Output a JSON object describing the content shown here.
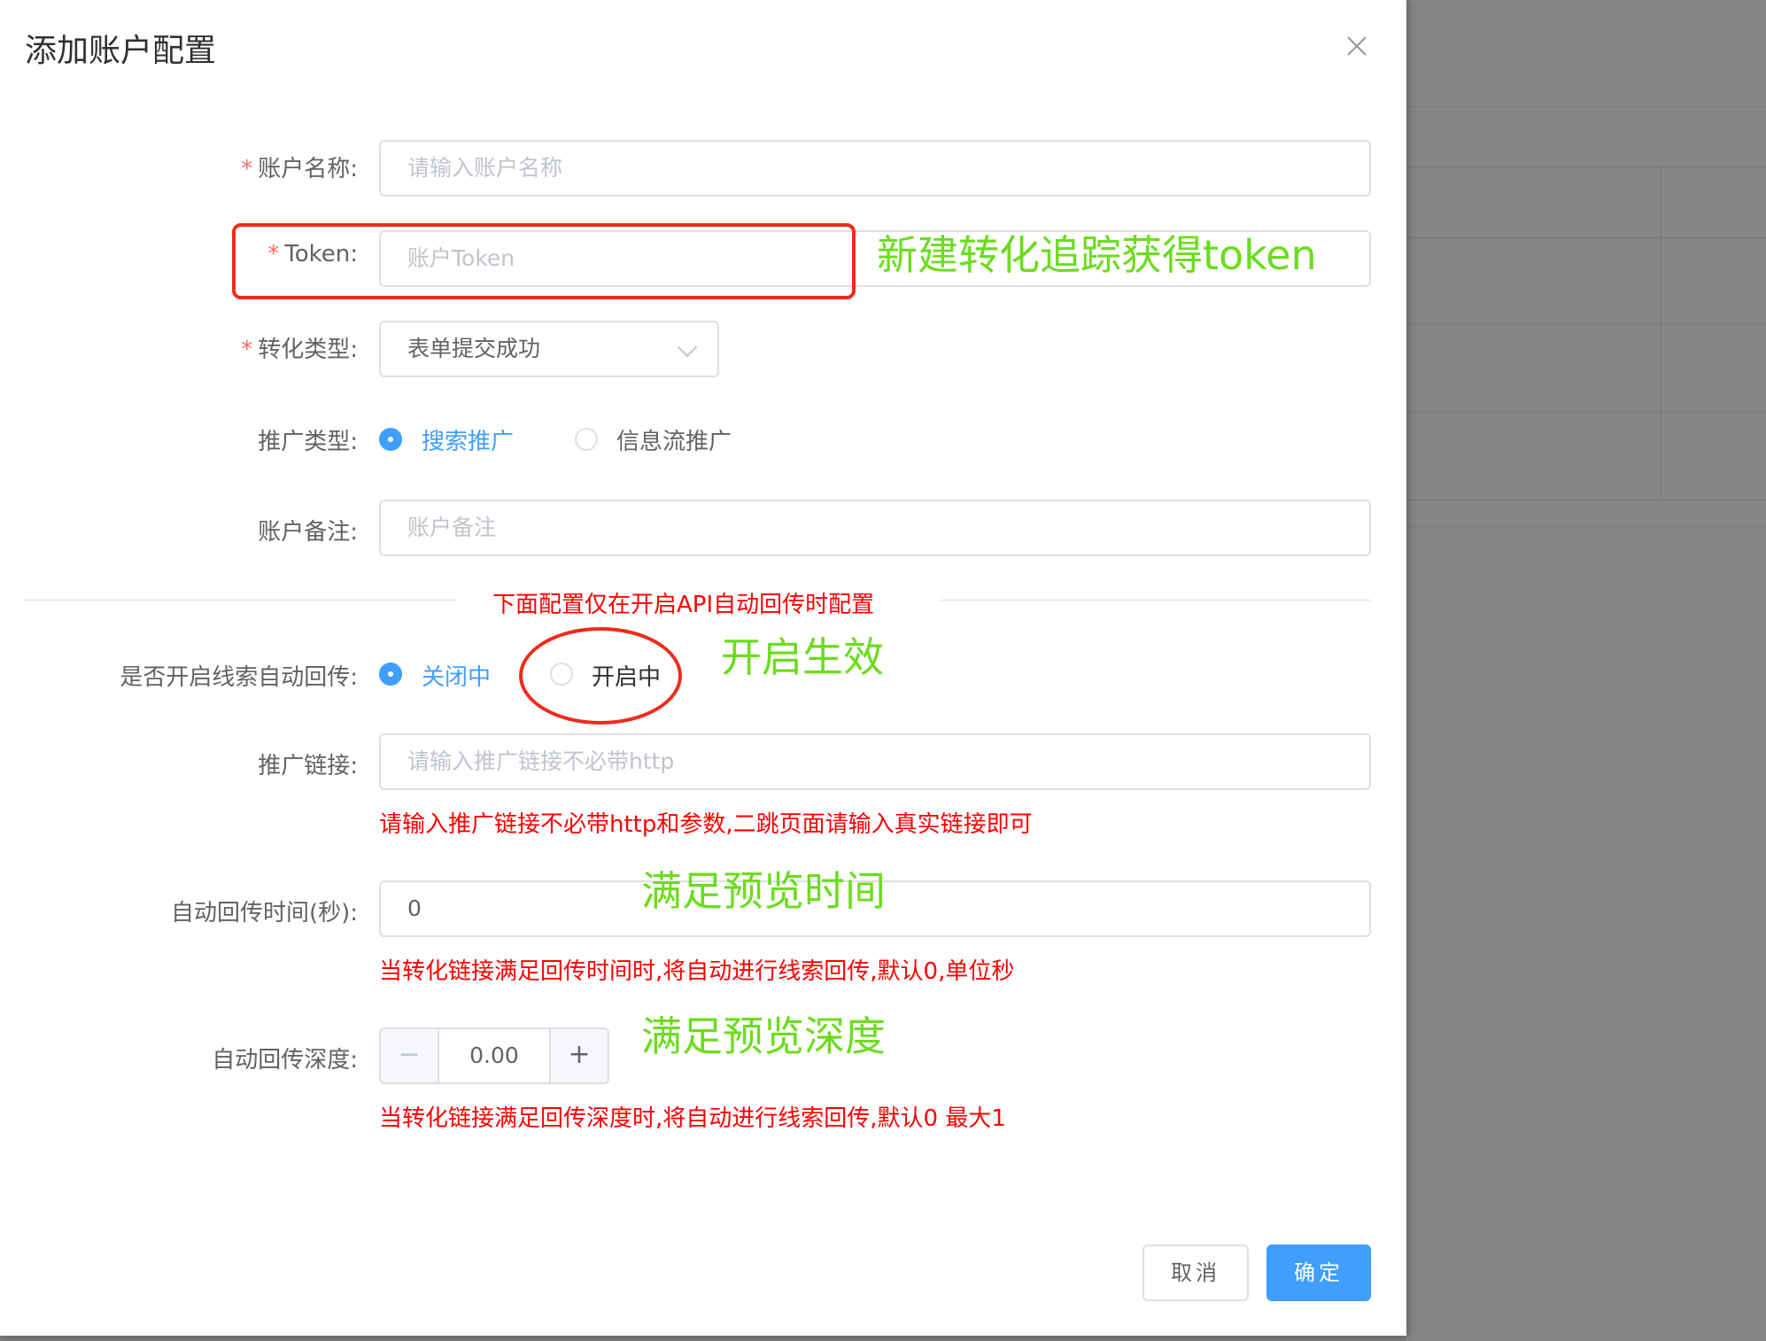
{
  "dialog": {
    "title": "添加账户配置",
    "fields": {
      "account_name": {
        "label": "账户名称:",
        "placeholder": "请输入账户名称",
        "required": true
      },
      "token": {
        "label": "Token:",
        "placeholder": "账户Token",
        "required": true
      },
      "conversion_type": {
        "label": "转化类型:",
        "value": "表单提交成功",
        "required": true
      },
      "promotion_type": {
        "label": "推广类型:",
        "options": [
          {
            "label": "搜索推广",
            "selected": true
          },
          {
            "label": "信息流推广",
            "selected": false
          }
        ]
      },
      "account_note": {
        "label": "账户备注:",
        "placeholder": "账户备注"
      },
      "auto_callback": {
        "label": "是否开启线索自动回传:",
        "options": [
          {
            "label": "关闭中",
            "selected": true
          },
          {
            "label": "开启中",
            "selected": false
          }
        ]
      },
      "promo_link": {
        "label": "推广链接:",
        "placeholder": "请输入推广链接不必带http",
        "hint": "请输入推广链接不必带http和参数,二跳页面请输入真实链接即可"
      },
      "callback_time": {
        "label": "自动回传时间(秒):",
        "value": "0",
        "hint": "当转化链接满足回传时间时,将自动进行线索回传,默认0,单位秒"
      },
      "callback_depth": {
        "label": "自动回传深度:",
        "value": "0.00",
        "minus": "−",
        "plus": "+",
        "hint": "当转化链接满足回传深度时,将自动进行线索回传,默认0 最大1"
      }
    },
    "divider_text": "下面配置仅在开启API自动回传时配置",
    "buttons": {
      "cancel": "取消",
      "confirm": "确定"
    }
  },
  "annotations": {
    "token_note": "新建转化追踪获得token",
    "enable_note": "开启生效",
    "time_note": "满足预览时间",
    "depth_note": "满足预览深度"
  },
  "colors": {
    "primary": "#409eff",
    "required_star": "#f56c6c",
    "annotation_green": "#6cdc1f",
    "annotation_red": "#f02a1a"
  }
}
